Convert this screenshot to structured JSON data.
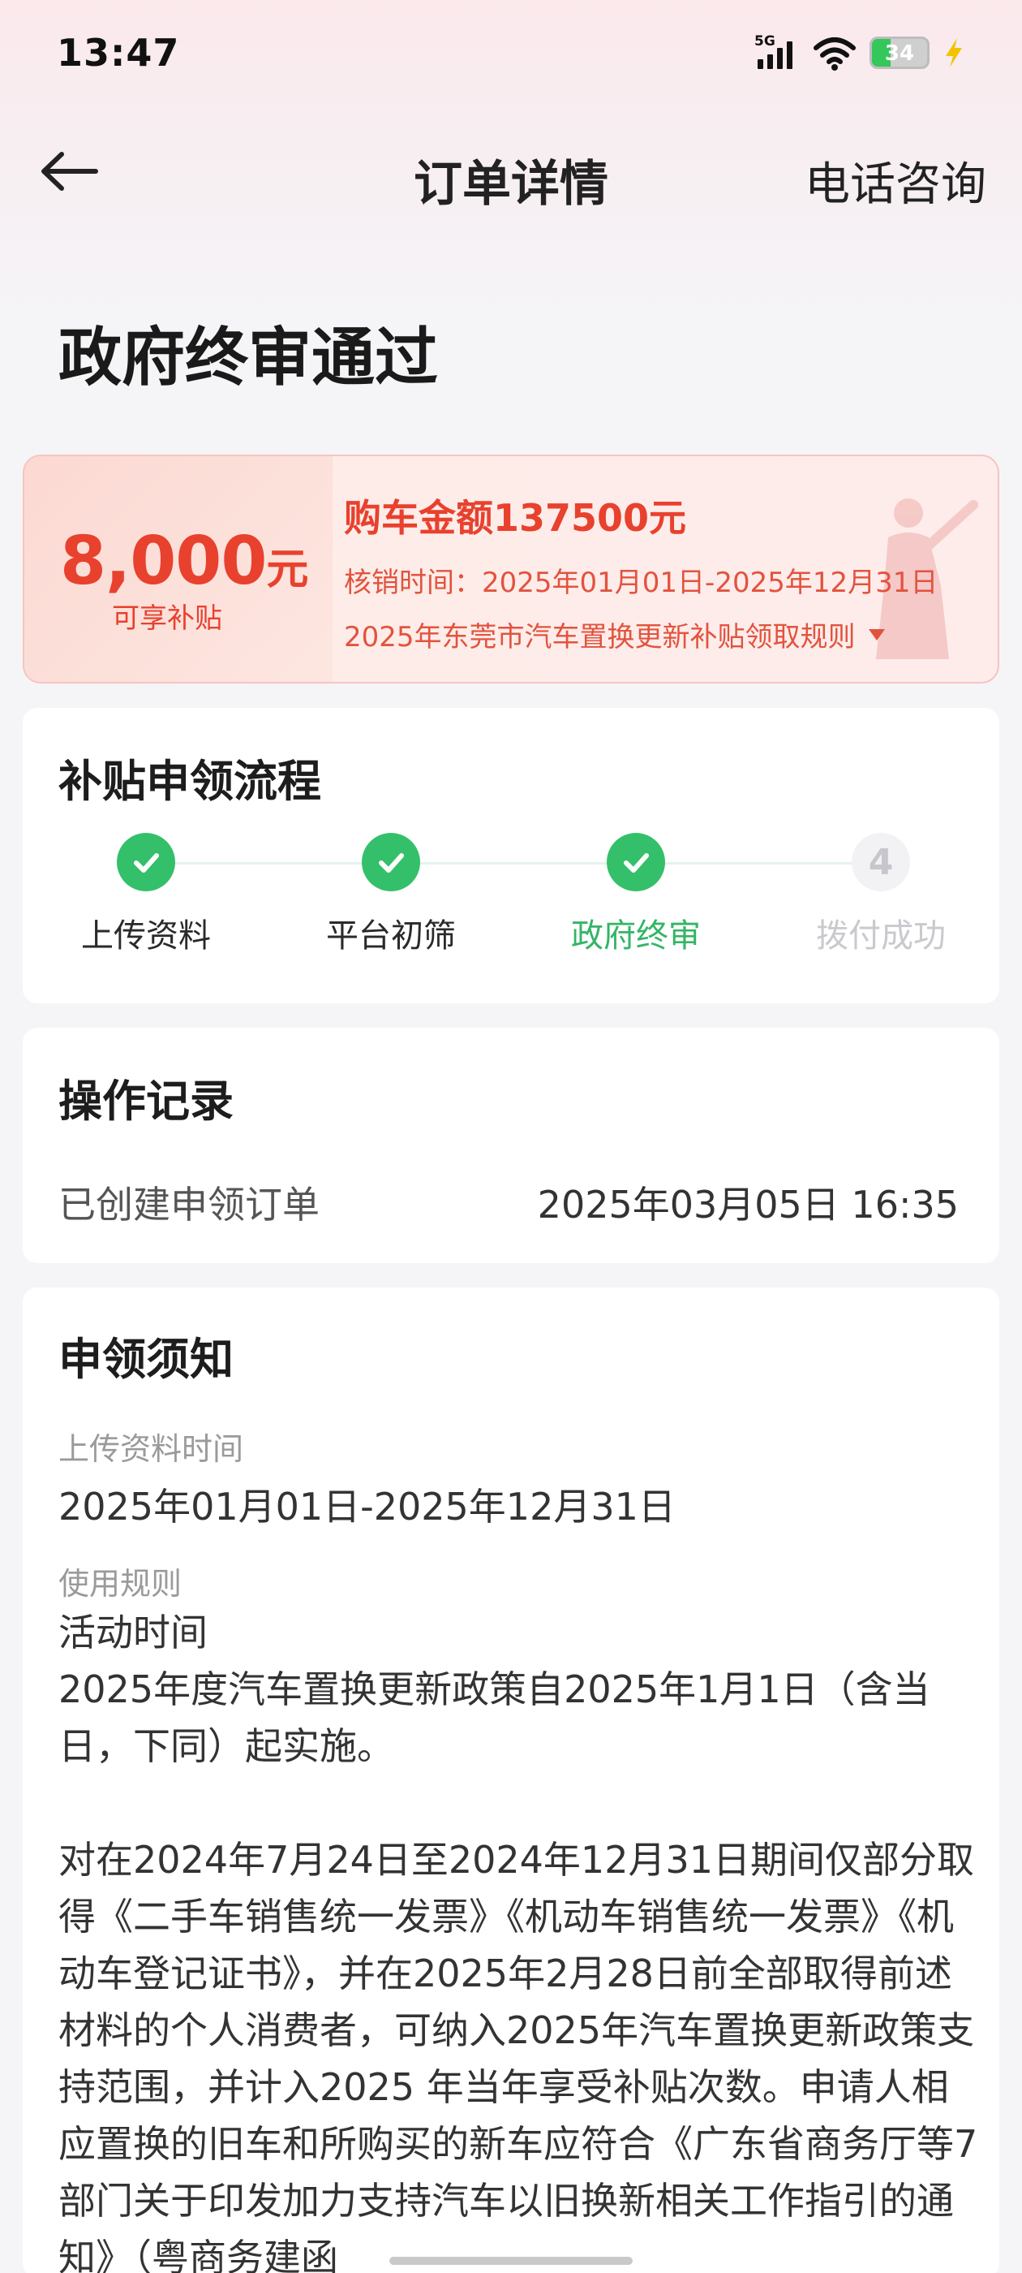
{
  "status_bar": {
    "time": "13:47",
    "network": "5G",
    "battery": "34",
    "battery_level": 0.34,
    "icons": [
      "signal-icon",
      "wifi-icon",
      "battery-icon",
      "charging-bolt-icon"
    ]
  },
  "nav": {
    "back_icon": "arrow-left-icon",
    "title": "订单详情",
    "action": "电话咨询"
  },
  "status_title": "政府终审通过",
  "subsidy": {
    "amount": "8,000",
    "unit": "元",
    "caption": "可享补贴",
    "purchase_amount": "购车金额137500元",
    "verify_time": "核销时间：2025年01月01日-2025年12月31日",
    "rules_link": "2025年东莞市汽车置换更新补贴领取规则",
    "accent_color": "#e8412e"
  },
  "process": {
    "title": "补贴申领流程",
    "steps": [
      {
        "label": "上传资料",
        "state": "done"
      },
      {
        "label": "平台初筛",
        "state": "done"
      },
      {
        "label": "政府终审",
        "state": "done-current"
      },
      {
        "label": "拨付成功",
        "state": "todo",
        "number": "4"
      }
    ],
    "done_color": "#34c06a"
  },
  "records": {
    "title": "操作记录",
    "items": [
      {
        "label": "已创建申领订单",
        "time": "2025年03月05日 16:35"
      }
    ]
  },
  "notice": {
    "title": "申领须知",
    "upload_label": "上传资料时间",
    "upload_value": "2025年01月01日-2025年12月31日",
    "rules_label": "使用规则",
    "rules_text": "活动时间\n2025年度汽车置换更新政策自2025年1月1日（含当日，下同）起实施。\n\n对在2024年7月24日至2024年12月31日期间仅部分取得《二手车销售统一发票》《机动车销售统一发票》《机动车登记证书》，并在2025年2月28日前全部取得前述材料的个人消费者，可纳入2025年汽车置换更新政策支持范围，并计入2025 年当年享受补贴次数。申请人相应置换的旧车和所购买的新车应符合《广东省商务厅等7部门关于印发加力支持汽车以旧换新相关工作指引的通知》（粤商务建函"
  }
}
